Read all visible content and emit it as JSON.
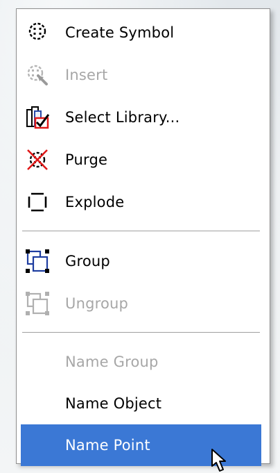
{
  "menu": {
    "items": [
      {
        "label": "Create Symbol",
        "icon": "create-symbol-icon",
        "enabled": true
      },
      {
        "label": "Insert",
        "icon": "insert-symbol-icon",
        "enabled": false
      },
      {
        "label": "Select Library...",
        "icon": "select-library-icon",
        "enabled": true
      },
      {
        "label": "Purge",
        "icon": "purge-icon",
        "enabled": true
      },
      {
        "label": "Explode",
        "icon": "explode-icon",
        "enabled": true
      },
      {
        "label": "Group",
        "icon": "group-icon",
        "enabled": true
      },
      {
        "label": "Ungroup",
        "icon": "ungroup-icon",
        "enabled": false
      },
      {
        "label": "Name Group",
        "enabled": false
      },
      {
        "label": "Name Object",
        "enabled": true
      },
      {
        "label": "Name Point",
        "enabled": true,
        "selected": true
      }
    ]
  },
  "colors": {
    "highlight": "#3b78d5",
    "disabled_text": "#a7a7a7",
    "accent_red": "#e01818"
  }
}
